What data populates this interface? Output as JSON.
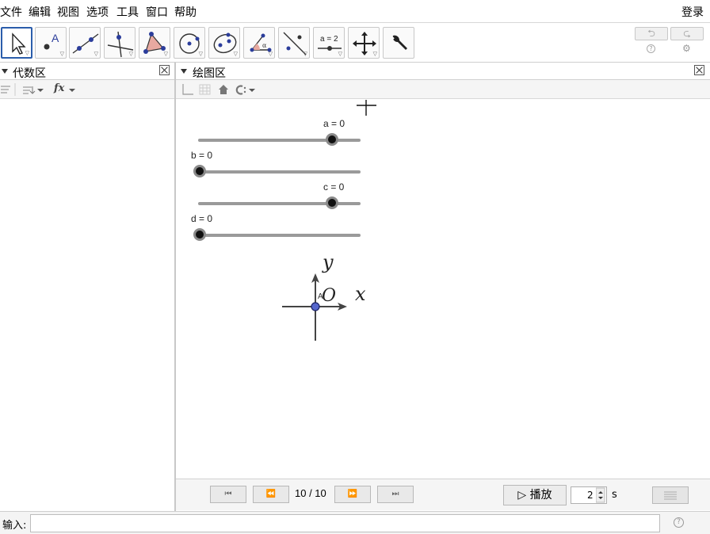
{
  "menu": {
    "items": [
      "文件",
      "编辑",
      "视图",
      "选项",
      "工具",
      "窗口",
      "帮助"
    ],
    "login": "登录"
  },
  "toolbar": {
    "tools": [
      {
        "name": "move-tool-icon",
        "active": true
      },
      {
        "name": "point-tool-icon",
        "label": "A"
      },
      {
        "name": "line-tool-icon"
      },
      {
        "name": "perpendicular-line-tool-icon"
      },
      {
        "name": "polygon-tool-icon"
      },
      {
        "name": "circle-tool-icon"
      },
      {
        "name": "ellipse-tool-icon"
      },
      {
        "name": "angle-tool-icon",
        "label": "α"
      },
      {
        "name": "reflect-tool-icon"
      },
      {
        "name": "slider-tool-icon",
        "label": "a = 2"
      },
      {
        "name": "move-graphics-view-tool-icon"
      },
      {
        "name": "wrench-tool-icon"
      }
    ],
    "undo_glyph": "⮌",
    "redo_glyph": "⮎",
    "help_glyph": "?",
    "settings_glyph": "⚙"
  },
  "algebra_panel": {
    "title": "代数区",
    "fx_label": "fx"
  },
  "graphics_panel": {
    "title": "绘图区",
    "sliders": [
      {
        "label": "a = 0",
        "value": 0
      },
      {
        "label": "b = 0",
        "value": 0
      },
      {
        "label": "c = 0",
        "value": 0
      },
      {
        "label": "d = 0",
        "value": 0
      }
    ],
    "axis_x_label": "x",
    "axis_y_label": "y",
    "origin_label": "O",
    "point_label": "A"
  },
  "navigation": {
    "step_text": "10 / 10",
    "first_glyph": "⏮",
    "prev_glyph": "⏪",
    "next_glyph": "⏩",
    "last_glyph": "⏭",
    "play_label": "▷ 播放",
    "speed_value": "2",
    "speed_unit": "s"
  },
  "input_bar": {
    "label": "输入:",
    "value": "",
    "help_glyph": "?"
  }
}
